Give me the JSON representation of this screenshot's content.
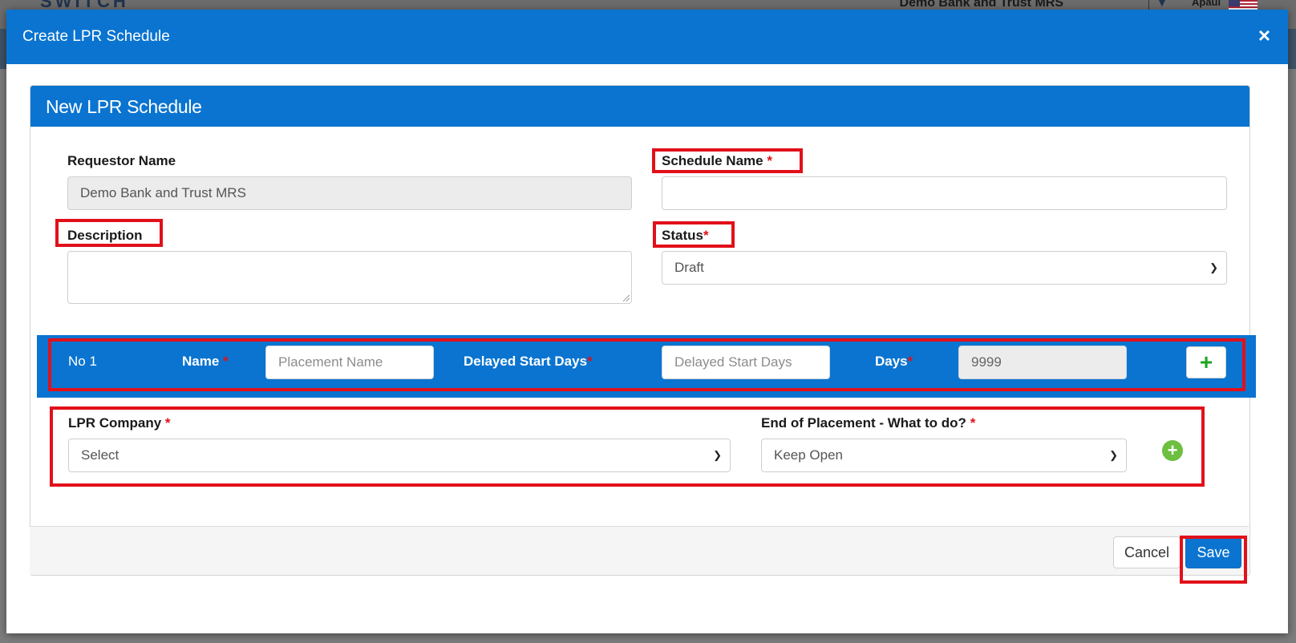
{
  "background": {
    "logo_text": "SWITCH",
    "bank_name": "Demo Bank and Trust MRS",
    "user_name": "Apaul"
  },
  "modal": {
    "title": "Create LPR Schedule",
    "close_label": "×"
  },
  "panel": {
    "title": "New LPR Schedule"
  },
  "form": {
    "requestor": {
      "label": "Requestor Name",
      "value": "Demo Bank and Trust MRS"
    },
    "schedule_name": {
      "label": "Schedule Name",
      "required_mark": "*",
      "value": ""
    },
    "description": {
      "label": "Description",
      "value": ""
    },
    "status": {
      "label": "Status",
      "required_mark": "*",
      "selected": "Draft"
    }
  },
  "placement": {
    "number_label": "No 1",
    "name_label": "Name",
    "name_required": "*",
    "name_placeholder": "Placement Name",
    "delayed_label": "Delayed Start Days",
    "delayed_required": "*",
    "delayed_placeholder": "Delayed Start Days",
    "days_label": "Days",
    "days_required": "*",
    "days_value": "9999",
    "add_label": "+"
  },
  "lpr": {
    "company_label": "LPR Company",
    "company_required": "*",
    "company_selected": "Select",
    "end_label": "End of Placement - What to do?",
    "end_required": "*",
    "end_selected": "Keep Open",
    "add_label": "+"
  },
  "footer": {
    "cancel_label": "Cancel",
    "save_label": "Save"
  },
  "colors": {
    "primary": "#0a74d0",
    "required": "#e1101a",
    "highlight": "#e1101a",
    "add_green": "#1ea51e"
  }
}
